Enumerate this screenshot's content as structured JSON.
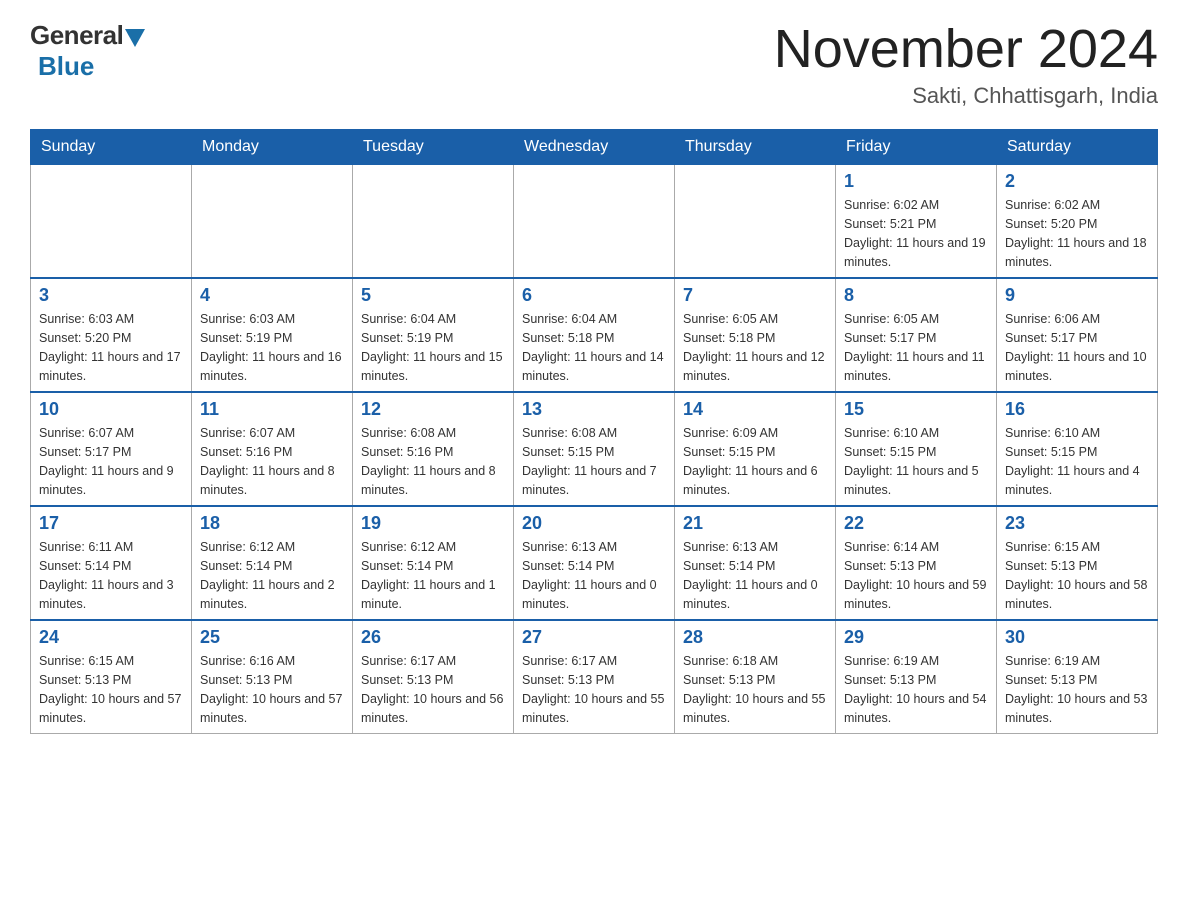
{
  "header": {
    "logo_general": "General",
    "logo_blue": "Blue",
    "month_title": "November 2024",
    "location": "Sakti, Chhattisgarh, India"
  },
  "days_of_week": [
    "Sunday",
    "Monday",
    "Tuesday",
    "Wednesday",
    "Thursday",
    "Friday",
    "Saturday"
  ],
  "weeks": [
    [
      {
        "day": "",
        "info": ""
      },
      {
        "day": "",
        "info": ""
      },
      {
        "day": "",
        "info": ""
      },
      {
        "day": "",
        "info": ""
      },
      {
        "day": "",
        "info": ""
      },
      {
        "day": "1",
        "info": "Sunrise: 6:02 AM\nSunset: 5:21 PM\nDaylight: 11 hours and 19 minutes."
      },
      {
        "day": "2",
        "info": "Sunrise: 6:02 AM\nSunset: 5:20 PM\nDaylight: 11 hours and 18 minutes."
      }
    ],
    [
      {
        "day": "3",
        "info": "Sunrise: 6:03 AM\nSunset: 5:20 PM\nDaylight: 11 hours and 17 minutes."
      },
      {
        "day": "4",
        "info": "Sunrise: 6:03 AM\nSunset: 5:19 PM\nDaylight: 11 hours and 16 minutes."
      },
      {
        "day": "5",
        "info": "Sunrise: 6:04 AM\nSunset: 5:19 PM\nDaylight: 11 hours and 15 minutes."
      },
      {
        "day": "6",
        "info": "Sunrise: 6:04 AM\nSunset: 5:18 PM\nDaylight: 11 hours and 14 minutes."
      },
      {
        "day": "7",
        "info": "Sunrise: 6:05 AM\nSunset: 5:18 PM\nDaylight: 11 hours and 12 minutes."
      },
      {
        "day": "8",
        "info": "Sunrise: 6:05 AM\nSunset: 5:17 PM\nDaylight: 11 hours and 11 minutes."
      },
      {
        "day": "9",
        "info": "Sunrise: 6:06 AM\nSunset: 5:17 PM\nDaylight: 11 hours and 10 minutes."
      }
    ],
    [
      {
        "day": "10",
        "info": "Sunrise: 6:07 AM\nSunset: 5:17 PM\nDaylight: 11 hours and 9 minutes."
      },
      {
        "day": "11",
        "info": "Sunrise: 6:07 AM\nSunset: 5:16 PM\nDaylight: 11 hours and 8 minutes."
      },
      {
        "day": "12",
        "info": "Sunrise: 6:08 AM\nSunset: 5:16 PM\nDaylight: 11 hours and 8 minutes."
      },
      {
        "day": "13",
        "info": "Sunrise: 6:08 AM\nSunset: 5:15 PM\nDaylight: 11 hours and 7 minutes."
      },
      {
        "day": "14",
        "info": "Sunrise: 6:09 AM\nSunset: 5:15 PM\nDaylight: 11 hours and 6 minutes."
      },
      {
        "day": "15",
        "info": "Sunrise: 6:10 AM\nSunset: 5:15 PM\nDaylight: 11 hours and 5 minutes."
      },
      {
        "day": "16",
        "info": "Sunrise: 6:10 AM\nSunset: 5:15 PM\nDaylight: 11 hours and 4 minutes."
      }
    ],
    [
      {
        "day": "17",
        "info": "Sunrise: 6:11 AM\nSunset: 5:14 PM\nDaylight: 11 hours and 3 minutes."
      },
      {
        "day": "18",
        "info": "Sunrise: 6:12 AM\nSunset: 5:14 PM\nDaylight: 11 hours and 2 minutes."
      },
      {
        "day": "19",
        "info": "Sunrise: 6:12 AM\nSunset: 5:14 PM\nDaylight: 11 hours and 1 minute."
      },
      {
        "day": "20",
        "info": "Sunrise: 6:13 AM\nSunset: 5:14 PM\nDaylight: 11 hours and 0 minutes."
      },
      {
        "day": "21",
        "info": "Sunrise: 6:13 AM\nSunset: 5:14 PM\nDaylight: 11 hours and 0 minutes."
      },
      {
        "day": "22",
        "info": "Sunrise: 6:14 AM\nSunset: 5:13 PM\nDaylight: 10 hours and 59 minutes."
      },
      {
        "day": "23",
        "info": "Sunrise: 6:15 AM\nSunset: 5:13 PM\nDaylight: 10 hours and 58 minutes."
      }
    ],
    [
      {
        "day": "24",
        "info": "Sunrise: 6:15 AM\nSunset: 5:13 PM\nDaylight: 10 hours and 57 minutes."
      },
      {
        "day": "25",
        "info": "Sunrise: 6:16 AM\nSunset: 5:13 PM\nDaylight: 10 hours and 57 minutes."
      },
      {
        "day": "26",
        "info": "Sunrise: 6:17 AM\nSunset: 5:13 PM\nDaylight: 10 hours and 56 minutes."
      },
      {
        "day": "27",
        "info": "Sunrise: 6:17 AM\nSunset: 5:13 PM\nDaylight: 10 hours and 55 minutes."
      },
      {
        "day": "28",
        "info": "Sunrise: 6:18 AM\nSunset: 5:13 PM\nDaylight: 10 hours and 55 minutes."
      },
      {
        "day": "29",
        "info": "Sunrise: 6:19 AM\nSunset: 5:13 PM\nDaylight: 10 hours and 54 minutes."
      },
      {
        "day": "30",
        "info": "Sunrise: 6:19 AM\nSunset: 5:13 PM\nDaylight: 10 hours and 53 minutes."
      }
    ]
  ]
}
